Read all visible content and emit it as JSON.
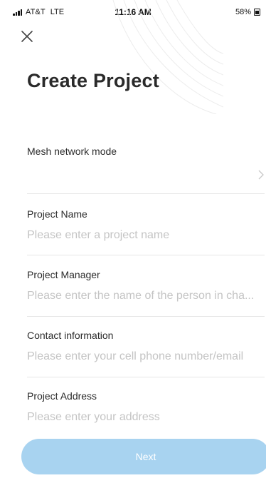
{
  "status_bar": {
    "carrier": "AT&T",
    "network": "LTE",
    "time": "11:16 AM",
    "battery": "58%"
  },
  "header": {
    "title": "Create Project"
  },
  "form": {
    "mesh": {
      "label": "Mesh network mode",
      "value": ""
    },
    "project_name": {
      "label": "Project Name",
      "placeholder": "Please enter a project name",
      "value": ""
    },
    "project_manager": {
      "label": "Project Manager",
      "placeholder": "Please enter the name of the person in cha...",
      "value": ""
    },
    "contact": {
      "label": "Contact information",
      "placeholder": "Please enter your cell phone number/email",
      "value": ""
    },
    "address": {
      "label": "Project Address",
      "placeholder": "Please enter your address",
      "value": ""
    }
  },
  "actions": {
    "next_label": "Next"
  },
  "icons": {
    "close": "close-icon",
    "chevron": "chevron-right-icon",
    "signal": "signal-bars-icon",
    "battery": "battery-icon"
  },
  "colors": {
    "primary_button": "#a8d3f0",
    "placeholder": "#c4c4c4",
    "divider": "#e6e6e6",
    "title": "#2a2a2a"
  }
}
